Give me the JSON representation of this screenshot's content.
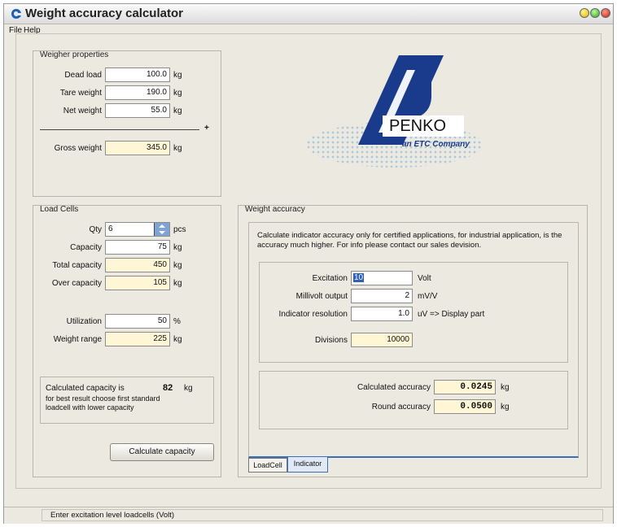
{
  "window": {
    "title": "Weight accuracy calculator"
  },
  "menu": {
    "file": "File",
    "help": "Help"
  },
  "weigher": {
    "title": "Weigher properties",
    "dead_load": {
      "label": "Dead load",
      "value": "100.0",
      "unit": "kg"
    },
    "tare_weight": {
      "label": "Tare weight",
      "value": "190.0",
      "unit": "kg"
    },
    "net_weight": {
      "label": "Net weight",
      "value": "55.0",
      "unit": "kg"
    },
    "plus": "+",
    "gross_weight": {
      "label": "Gross weight",
      "value": "345.0",
      "unit": "kg"
    }
  },
  "logo": {
    "brand": "PENKO",
    "tagline": "an ETC Company",
    "color": "#1a3a8c"
  },
  "loadcells": {
    "title": "Load Cells",
    "qty": {
      "label": "Qty",
      "value": "6",
      "unit": "pcs"
    },
    "capacity": {
      "label": "Capacity",
      "value": "75",
      "unit": "kg"
    },
    "total_capacity": {
      "label": "Total capacity",
      "value": "450",
      "unit": "kg"
    },
    "over_capacity": {
      "label": "Over capacity",
      "value": "105",
      "unit": "kg"
    },
    "utilization": {
      "label": "Utilization",
      "value": "50",
      "unit": "%"
    },
    "weight_range": {
      "label": "Weight range",
      "value": "225",
      "unit": "kg"
    },
    "calc_text": "Calculated capacity is",
    "calc_value": "82",
    "calc_unit": "kg",
    "calc_note": "for best result choose first standard loadcell with lower capacity",
    "calc_button": "Calculate capacity"
  },
  "accuracy": {
    "title": "Weight accuracy",
    "info": "Calculate indicator accuracy only for certified applications, for industrial application, is the accuracy  much higher. For info please contact our sales devision.",
    "excitation": {
      "label": "Excitation",
      "value": "10",
      "unit": "Volt"
    },
    "millivolt": {
      "label": "Millivolt output",
      "value": "2",
      "unit": "mV/V"
    },
    "resolution": {
      "label": "Indicator resolution",
      "value": "1.0",
      "unit": "uV => Display part"
    },
    "divisions": {
      "label": "Divisions",
      "value": "10000"
    },
    "calculated": {
      "label": "Calculated accuracy",
      "value": "0.0245",
      "unit": "kg"
    },
    "round": {
      "label": "Round accuracy",
      "value": "0.0500",
      "unit": "kg"
    },
    "tabs": [
      "LoadCell",
      "Indicator"
    ]
  },
  "status": {
    "text": "Enter excitation level loadcells (Volt)"
  }
}
